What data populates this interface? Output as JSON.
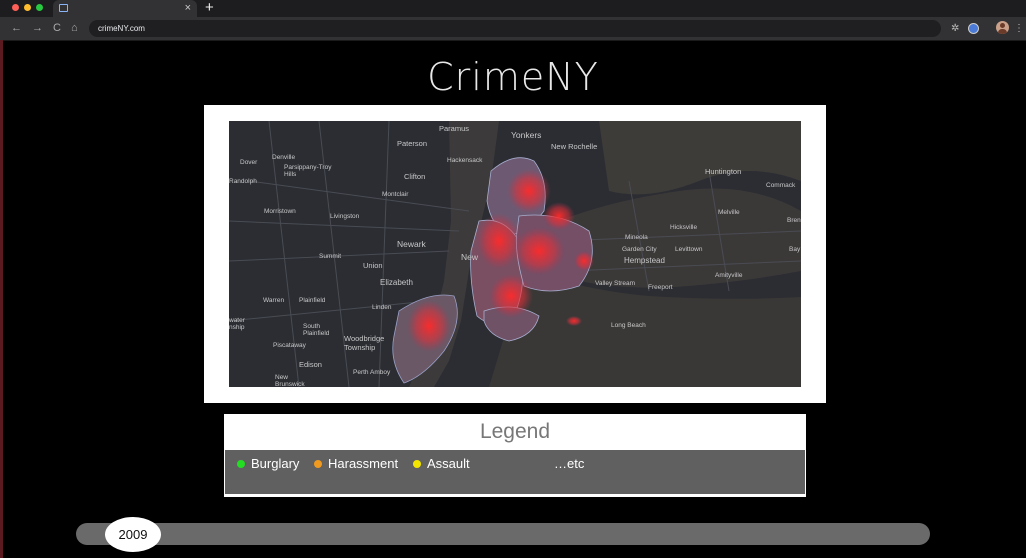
{
  "browser": {
    "url": "crimeNY.com",
    "tab_close": "×",
    "new_tab": "+",
    "nav": {
      "back": "←",
      "forward": "→",
      "reload": "C",
      "home": "⌂"
    },
    "ext_icon_1": "✲",
    "menu": "⋮"
  },
  "page": {
    "title": "CrimeNY"
  },
  "map": {
    "labels": [
      {
        "text": "Paramus"
      },
      {
        "text": "Yonkers"
      },
      {
        "text": "Paterson"
      },
      {
        "text": "New Rochelle"
      },
      {
        "text": "Hackensack"
      },
      {
        "text": "Denville"
      },
      {
        "text": "Dover"
      },
      {
        "text": "Parsippany-Troy Hills"
      },
      {
        "text": "Clifton"
      },
      {
        "text": "Randolph"
      },
      {
        "text": "Huntington"
      },
      {
        "text": "Commack"
      },
      {
        "text": "Montclair"
      },
      {
        "text": "Morristown"
      },
      {
        "text": "Livingston"
      },
      {
        "text": "Melville"
      },
      {
        "text": "Hicksville"
      },
      {
        "text": "Bren"
      },
      {
        "text": "Newark"
      },
      {
        "text": "Mineola"
      },
      {
        "text": "Garden City"
      },
      {
        "text": "Levittown"
      },
      {
        "text": "Bay"
      },
      {
        "text": "Summit"
      },
      {
        "text": "New"
      },
      {
        "text": "Hempstead"
      },
      {
        "text": "Union"
      },
      {
        "text": "Amityville"
      },
      {
        "text": "Elizabeth"
      },
      {
        "text": "Valley Stream"
      },
      {
        "text": "Freeport"
      },
      {
        "text": "Warren"
      },
      {
        "text": "Plainfield"
      },
      {
        "text": "Linden"
      },
      {
        "text": "Long Beach"
      },
      {
        "text": "water"
      },
      {
        "text": "nship"
      },
      {
        "text": "South Plainfield"
      },
      {
        "text": "Woodbridge Township"
      },
      {
        "text": "Piscataway"
      },
      {
        "text": "Edison"
      },
      {
        "text": "Perth Amboy"
      },
      {
        "text": "New Brunswick"
      }
    ]
  },
  "legend": {
    "title": "Legend",
    "items": [
      {
        "label": "Burglary",
        "color": "#22dd22"
      },
      {
        "label": "Harassment",
        "color": "#ef9a1e"
      },
      {
        "label": "Assault",
        "color": "#f2e600"
      }
    ],
    "etc": "…etc"
  },
  "timeline": {
    "year": "2009",
    "progress": 0.05
  }
}
